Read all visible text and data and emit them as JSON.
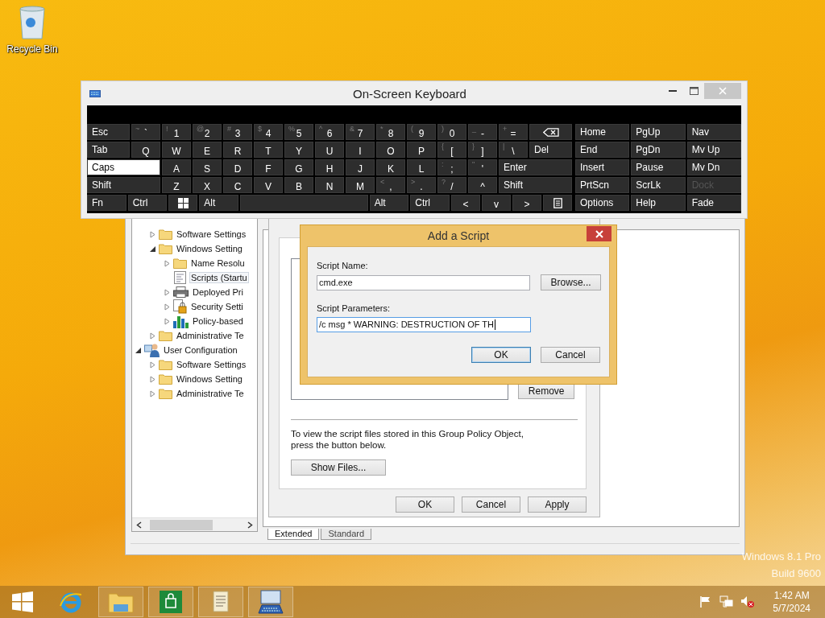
{
  "desktop_icons": [
    {
      "label": "Recycle Bin"
    }
  ],
  "keyboard": {
    "title": "On-Screen Keyboard",
    "rows": [
      [
        {
          "kind": "mod",
          "label": "Esc",
          "on": false
        },
        {
          "kind": "char",
          "label": "`",
          "shift": "~",
          "on": false
        },
        {
          "kind": "char",
          "label": "1",
          "shift": "!",
          "on": false
        },
        {
          "kind": "char",
          "label": "2",
          "shift": "@",
          "on": false
        },
        {
          "kind": "char",
          "label": "3",
          "shift": "#",
          "on": false
        },
        {
          "kind": "char",
          "label": "4",
          "shift": "$",
          "on": false
        },
        {
          "kind": "char",
          "label": "5",
          "shift": "%",
          "on": false
        },
        {
          "kind": "char",
          "label": "6",
          "shift": "^",
          "on": false
        },
        {
          "kind": "char",
          "label": "7",
          "shift": "&",
          "on": false
        },
        {
          "kind": "char",
          "label": "8",
          "shift": "*",
          "on": false
        },
        {
          "kind": "char",
          "label": "9",
          "shift": "(",
          "on": false
        },
        {
          "kind": "char",
          "label": "0",
          "shift": ")",
          "on": false
        },
        {
          "kind": "char",
          "label": "-",
          "shift": "_",
          "on": false
        },
        {
          "kind": "char",
          "label": "=",
          "shift": "+",
          "on": false
        },
        {
          "kind": "backspace",
          "on": false
        }
      ],
      [
        {
          "kind": "mod",
          "label": "Tab",
          "on": false
        },
        {
          "kind": "char",
          "label": "Q",
          "on": false
        },
        {
          "kind": "char",
          "label": "W",
          "on": false
        },
        {
          "kind": "char",
          "label": "E",
          "on": false
        },
        {
          "kind": "char",
          "label": "R",
          "on": false
        },
        {
          "kind": "char",
          "label": "T",
          "on": false
        },
        {
          "kind": "char",
          "label": "Y",
          "on": false
        },
        {
          "kind": "char",
          "label": "U",
          "on": false
        },
        {
          "kind": "char",
          "label": "I",
          "on": false
        },
        {
          "kind": "char",
          "label": "O",
          "on": false
        },
        {
          "kind": "char",
          "label": "P",
          "on": false
        },
        {
          "kind": "char",
          "label": "[",
          "shift": "{",
          "on": false
        },
        {
          "kind": "char",
          "label": "]",
          "shift": "}",
          "on": false
        },
        {
          "kind": "char",
          "label": "\\",
          "shift": "|",
          "on": false
        },
        {
          "kind": "mod",
          "label": "Del",
          "on": false
        }
      ],
      [
        {
          "kind": "mod",
          "label": "Caps",
          "on": true
        },
        {
          "kind": "char",
          "label": "A",
          "on": false
        },
        {
          "kind": "char",
          "label": "S",
          "on": false
        },
        {
          "kind": "char",
          "label": "D",
          "on": false
        },
        {
          "kind": "char",
          "label": "F",
          "on": false
        },
        {
          "kind": "char",
          "label": "G",
          "on": false
        },
        {
          "kind": "char",
          "label": "H",
          "on": false
        },
        {
          "kind": "char",
          "label": "J",
          "on": false
        },
        {
          "kind": "char",
          "label": "K",
          "on": false
        },
        {
          "kind": "char",
          "label": "L",
          "on": false
        },
        {
          "kind": "char",
          "label": ";",
          "shift": ":",
          "on": false
        },
        {
          "kind": "char",
          "label": "'",
          "shift": "\"",
          "on": false
        },
        {
          "kind": "mod",
          "label": "Enter",
          "on": false
        }
      ],
      [
        {
          "kind": "mod",
          "label": "Shift",
          "on": false
        },
        {
          "kind": "char",
          "label": "Z",
          "on": false
        },
        {
          "kind": "char",
          "label": "X",
          "on": false
        },
        {
          "kind": "char",
          "label": "C",
          "on": false
        },
        {
          "kind": "char",
          "label": "V",
          "on": false
        },
        {
          "kind": "char",
          "label": "B",
          "on": false
        },
        {
          "kind": "char",
          "label": "N",
          "on": false
        },
        {
          "kind": "char",
          "label": "M",
          "on": false
        },
        {
          "kind": "char",
          "label": ",",
          "shift": "<",
          "on": false
        },
        {
          "kind": "char",
          "label": ".",
          "shift": ">",
          "on": false
        },
        {
          "kind": "char",
          "label": "/",
          "shift": "?",
          "on": false
        },
        {
          "kind": "char",
          "label": "^",
          "on": false
        },
        {
          "kind": "mod",
          "label": "Shift",
          "on": false
        }
      ],
      [
        {
          "kind": "mod",
          "label": "Fn",
          "on": false
        },
        {
          "kind": "mod",
          "label": "Ctrl",
          "on": false
        },
        {
          "kind": "windows",
          "on": false
        },
        {
          "kind": "mod",
          "label": "Alt",
          "on": false
        },
        {
          "kind": "space",
          "on": false
        },
        {
          "kind": "mod",
          "label": "Alt",
          "on": false
        },
        {
          "kind": "mod",
          "label": "Ctrl",
          "on": false
        },
        {
          "kind": "char",
          "label": "<",
          "on": false
        },
        {
          "kind": "char",
          "label": "v",
          "on": false
        },
        {
          "kind": "char",
          "label": ">",
          "on": false
        },
        {
          "kind": "menu",
          "on": false
        }
      ]
    ],
    "nav_keys": [
      {
        "label": "Home",
        "disabled": false
      },
      {
        "label": "PgUp",
        "disabled": false
      },
      {
        "label": "Nav",
        "disabled": false
      },
      {
        "label": "End",
        "disabled": false
      },
      {
        "label": "PgDn",
        "disabled": false
      },
      {
        "label": "Mv Up",
        "disabled": false
      },
      {
        "label": "Insert",
        "disabled": false
      },
      {
        "label": "Pause",
        "disabled": false
      },
      {
        "label": "Mv Dn",
        "disabled": false
      },
      {
        "label": "PrtScn",
        "disabled": false
      },
      {
        "label": "ScrLk",
        "disabled": false
      },
      {
        "label": "Dock",
        "disabled": true
      },
      {
        "label": "Options",
        "disabled": false
      },
      {
        "label": "Help",
        "disabled": false
      },
      {
        "label": "Fade",
        "disabled": false
      }
    ]
  },
  "gpo": {
    "tree": [
      {
        "children": [
          {
            "label": "Software Settings",
            "kind": "folder",
            "expanded": false,
            "selected": false
          },
          {
            "label": "Windows Setting",
            "kind": "folder",
            "expanded": true,
            "selected": false,
            "children": [
              {
                "label": "Name Resolu",
                "kind": "folder",
                "expanded": false,
                "selected": false
              },
              {
                "label": "Scripts (Startu",
                "kind": "script",
                "selected": true
              },
              {
                "label": "Deployed Pri",
                "kind": "printer",
                "expanded": false,
                "selected": false
              },
              {
                "label": "Security Setti",
                "kind": "security",
                "expanded": false,
                "selected": false
              },
              {
                "label": "Policy-based",
                "kind": "chart",
                "expanded": false,
                "selected": false
              }
            ]
          },
          {
            "label": "Administrative Te",
            "kind": "folder",
            "expanded": false,
            "selected": false
          }
        ]
      },
      {
        "label": "User Configuration",
        "kind": "users",
        "expanded": true,
        "selected": false,
        "children": [
          {
            "label": "Software Settings",
            "kind": "folder",
            "expanded": false,
            "selected": false
          },
          {
            "label": "Windows Setting",
            "kind": "folder",
            "expanded": false,
            "selected": false
          },
          {
            "label": "Administrative Te",
            "kind": "folder",
            "expanded": false,
            "selected": false
          }
        ]
      }
    ],
    "tabs": [
      {
        "label": "Extended",
        "selected": true
      },
      {
        "label": "Standard",
        "selected": false
      }
    ]
  },
  "properties": {
    "remove_button": "Remove",
    "info_text": "To view the script files stored in this Group Policy Object, press the button below.",
    "show_files_button": "Show Files...",
    "buttons": [
      "OK",
      "Cancel",
      "Apply"
    ]
  },
  "add_script": {
    "title": "Add a Script",
    "fields": [
      {
        "label": "Script Name:",
        "value": "cmd.exe",
        "focused": false,
        "button": "Browse..."
      },
      {
        "label": "Script Parameters:",
        "value": "/c msg * WARNING: DESTRUCTION OF TH",
        "focused": true
      }
    ],
    "buttons": [
      {
        "label": "OK",
        "default": true
      },
      {
        "label": "Cancel",
        "default": false
      }
    ]
  },
  "watermark": [
    "Windows 8.1 Pro",
    "Build 9600"
  ],
  "taskbar": {
    "apps": [
      {
        "kind": "ie",
        "running": false
      },
      {
        "kind": "explorer",
        "running": true
      },
      {
        "kind": "store",
        "running": true
      },
      {
        "kind": "notes",
        "running": true
      },
      {
        "kind": "keyboard",
        "running": true
      }
    ],
    "tray": [
      {
        "kind": "flag"
      },
      {
        "kind": "network"
      },
      {
        "kind": "volume"
      }
    ],
    "clock": {
      "time": "1:42 AM",
      "date": "5/7/2024"
    }
  }
}
